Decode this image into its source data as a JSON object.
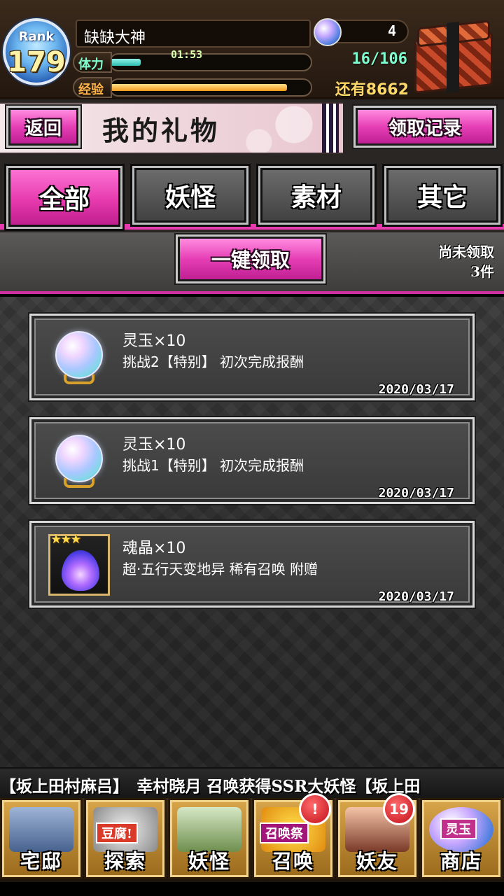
{
  "player": {
    "rank_word": "Rank",
    "rank": "179",
    "name": "缺缺大神",
    "stamina_label": "体力",
    "stamina_timer": "01:53",
    "stamina_fraction": 0.15,
    "exp_label": "经验",
    "exp_fraction": 0.88,
    "gems": "4",
    "ap": "16/106",
    "remaining": "还有8662"
  },
  "header": {
    "back_label": "返回",
    "title": "我的礼物",
    "record_label": "领取记录"
  },
  "tabs": [
    {
      "label": "全部",
      "active": true
    },
    {
      "label": "妖怪",
      "active": false
    },
    {
      "label": "素材",
      "active": false
    },
    {
      "label": "其它",
      "active": false
    }
  ],
  "actions": {
    "claim_all_label": "一键领取",
    "unclaimed_title": "尚未领取",
    "unclaimed_count": "3件"
  },
  "gifts": [
    {
      "name": "灵玉×10",
      "desc": "挑战2【特别】 初次完成报酬",
      "date": "2020/03/17",
      "icon": "spirit-jade-orb-icon"
    },
    {
      "name": "灵玉×10",
      "desc": "挑战1【特别】 初次完成报酬",
      "date": "2020/03/17",
      "icon": "spirit-jade-orb-icon"
    },
    {
      "name": "魂晶×10",
      "desc": "超·五行天变地异 稀有召唤 附赠",
      "date": "2020/03/17",
      "icon": "soul-crystal-icon",
      "stars": "★★★"
    }
  ],
  "ticker": "【坂上田村麻吕】　幸村晓月 召唤获得SSR大妖怪【坂上田",
  "nav": [
    {
      "label": "宅邸",
      "badge": ""
    },
    {
      "label": "探索",
      "badge": "",
      "tag": "豆腐!"
    },
    {
      "label": "妖怪",
      "badge": ""
    },
    {
      "label": "召唤",
      "badge": "!",
      "tag": "召唤祭"
    },
    {
      "label": "妖友",
      "badge": "19"
    },
    {
      "label": "商店",
      "badge": "",
      "tag": "灵玉"
    }
  ],
  "colors": {
    "accent_pink": "#e63aae",
    "stamina": "#2fbfb4",
    "exp": "#f29a1c"
  }
}
